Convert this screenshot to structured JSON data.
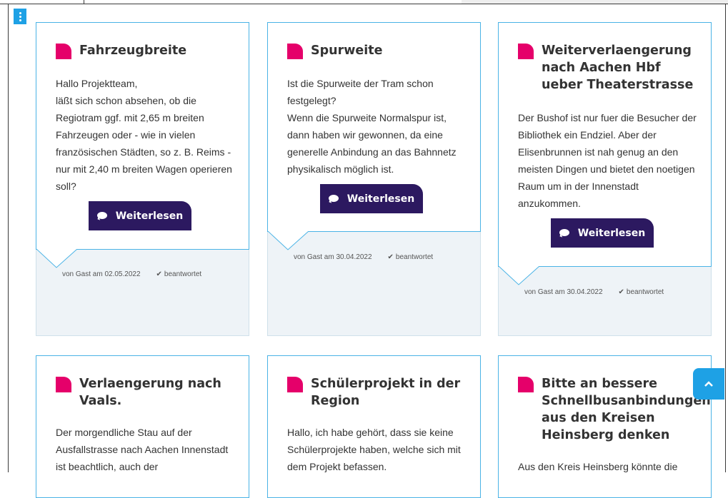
{
  "cards": [
    {
      "title": "Fahrzeugbreite",
      "text": "Hallo Projektteam,\nläßt sich schon absehen, ob die Regiotram ggf. mit 2,65 m breiten Fahrzeugen oder - wie in vielen französischen Städten, so z. B. Reims - nur mit 2,40 m breiten Wagen operieren soll?",
      "button": "Weiterlesen",
      "author_date": "von Gast am 02.05.2022",
      "status": "beantwortet"
    },
    {
      "title": "Spurweite",
      "text": "Ist die Spurweite der Tram schon festgelegt?\nWenn die Spurweite Normalspur ist, dann haben wir gewonnen, da eine generelle Anbindung an das Bahnnetz physikalisch möglich ist.",
      "button": "Weiterlesen",
      "author_date": "von Gast am 30.04.2022",
      "status": "beantwortet"
    },
    {
      "title": "Weiterverlaengerung nach Aachen Hbf ueber Theaterstrasse",
      "text": "Der Bushof ist nur fuer die Besucher der Bibliothek ein Endziel. Aber der Elisenbrunnen ist nah genug an den meisten Dingen und bietet den noetigen Raum um in der Innenstadt anzukommen.",
      "button": "Weiterlesen",
      "author_date": "von Gast am 30.04.2022",
      "status": "beantwortet"
    },
    {
      "title": "Verlaengerung nach Vaals.",
      "text": "Der morgendliche Stau auf der Ausfallstrasse nach Aachen Innenstadt ist beachtlich, auch der"
    },
    {
      "title": "Schülerprojekt in der Region",
      "text": "Hallo, ich habe gehört, dass sie keine Schülerprojekte haben, welche sich mit dem Projekt befassen."
    },
    {
      "title": "Bitte an bessere Schnellbusanbindungen aus den Kreisen Heinsberg denken",
      "text": "Aus den Kreis Heinsberg könnte die"
    }
  ],
  "icons": {
    "menu": "vertical-dots-icon",
    "scroll_top": "chevron-up-icon",
    "title_marker": "speech-flag-icon",
    "button": "chat-icon",
    "status": "check-icon"
  },
  "colors": {
    "accent": "#1ea1e5",
    "title_marker": "#e5006a",
    "button_bg": "#2c1960",
    "card_bg": "#eef3f7",
    "bubble_border": "#4ab3e6"
  }
}
